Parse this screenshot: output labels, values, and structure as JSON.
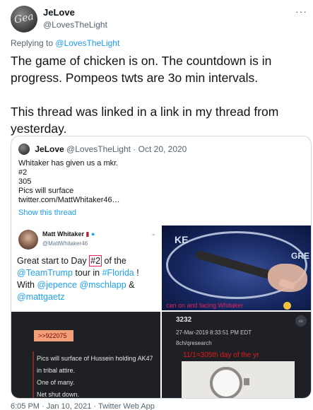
{
  "author": {
    "name": "JeLove",
    "handle": "@LovesTheLight",
    "avatar_text": "Gea"
  },
  "more_icon": "···",
  "reply": {
    "prefix": "Replying to",
    "to": "@LovesTheLight"
  },
  "tweet": {
    "text": "The game of chicken is on.  The countdown is in progress.  Pompeos twts are 3o min intervals.\n\nThis thread was linked in a link in my thread from yesterday."
  },
  "quote": {
    "name": "JeLove",
    "handle": "@LovesTheLight",
    "separator": "·",
    "date": "Oct 20, 2020",
    "lines": [
      "Whitaker has given us a mkr.",
      "#2",
      "305",
      "Pics will surface",
      "twitter.com/MattWhitaker46…"
    ],
    "show_thread": "Show this thread"
  },
  "media": {
    "embedded_tweet": {
      "name": "Matt Whitaker",
      "handle": "@MattWhitaker46",
      "text_1": "Great start to Day ",
      "text_boxed": "#2",
      "text_2": " of the ",
      "mention_1": "@TeamTrump",
      "text_3": " tour in ",
      "hashtag": "#Florida",
      "text_4": " ! With ",
      "mention_2": "@jepence",
      "mention_3": "@mschlapp",
      "text_5": " & ",
      "mention_4": "@mattgaetz"
    },
    "pen_photo": {
      "caption": "can on and facing Whitaker",
      "bg_text_1": "KE",
      "bg_text_2": "GRE"
    },
    "board_post_left": {
      "tag": ">>922075",
      "lines": [
        "Pics will surface of Hussein holding AK47",
        "in tribal attire.",
        "One of many.",
        "Net shut down."
      ]
    },
    "board_post_right": {
      "post_id": "3232",
      "date": "27-Mar-2019 8:33:51 PM EDT",
      "board": "8ch/qresearch",
      "red_text": "11/1=305th day of the yr"
    }
  },
  "footer": {
    "time": "6:05 PM",
    "separator": "·",
    "date": "Jan 10, 2021",
    "source": "Twitter Web App"
  },
  "colors": {
    "accent": "#1d9bf0",
    "text": "#0f1419",
    "muted": "#536471",
    "border": "#cfd9de"
  }
}
